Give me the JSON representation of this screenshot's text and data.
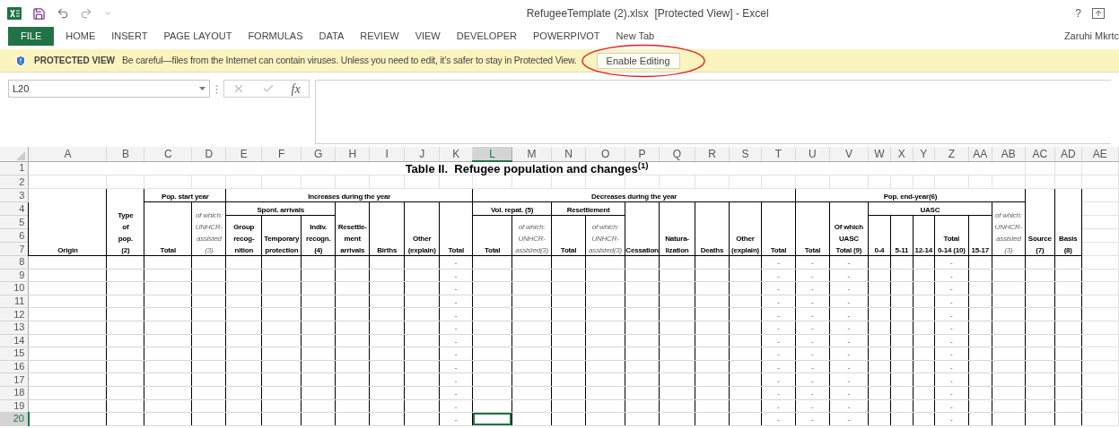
{
  "window": {
    "title": "RefugeeTemplate (2).xlsx  [Protected View] - Excel",
    "help": "?",
    "user": "Zaruhi Mkrtc"
  },
  "ribbon_tabs": [
    {
      "label": "FILE",
      "kind": "file"
    },
    {
      "label": "HOME",
      "kind": "tab"
    },
    {
      "label": "INSERT",
      "kind": "tab"
    },
    {
      "label": "PAGE LAYOUT",
      "kind": "tab"
    },
    {
      "label": "FORMULAS",
      "kind": "tab"
    },
    {
      "label": "DATA",
      "kind": "tab"
    },
    {
      "label": "REVIEW",
      "kind": "tab"
    },
    {
      "label": "VIEW",
      "kind": "tab"
    },
    {
      "label": "DEVELOPER",
      "kind": "tab"
    },
    {
      "label": "POWERPIVOT",
      "kind": "tab"
    },
    {
      "label": "New Tab",
      "kind": "tab"
    }
  ],
  "protected_view": {
    "title": "PROTECTED VIEW",
    "message": "Be careful—files from the Internet can contain viruses. Unless you need to edit, it’s safer to stay in Protected View.",
    "button": "Enable Editing"
  },
  "formula_bar": {
    "name_box": "L20",
    "function_label": "fx"
  },
  "sheet": {
    "columns": [
      {
        "label": "A",
        "selected": false
      },
      {
        "label": "B",
        "selected": false
      },
      {
        "label": "C",
        "selected": false
      },
      {
        "label": "D",
        "selected": false
      },
      {
        "label": "E",
        "selected": false
      },
      {
        "label": "F",
        "selected": false
      },
      {
        "label": "G",
        "selected": false
      },
      {
        "label": "H",
        "selected": false
      },
      {
        "label": "I",
        "selected": false
      },
      {
        "label": "J",
        "selected": false
      },
      {
        "label": "K",
        "selected": false
      },
      {
        "label": "L",
        "selected": true
      },
      {
        "label": "M",
        "selected": false
      },
      {
        "label": "N",
        "selected": false
      },
      {
        "label": "O",
        "selected": false
      },
      {
        "label": "P",
        "selected": false
      },
      {
        "label": "Q",
        "selected": false
      },
      {
        "label": "R",
        "selected": false
      },
      {
        "label": "S",
        "selected": false
      },
      {
        "label": "T",
        "selected": false
      },
      {
        "label": "U",
        "selected": false
      },
      {
        "label": "V",
        "selected": false
      },
      {
        "label": "W",
        "selected": false
      },
      {
        "label": "X",
        "selected": false
      },
      {
        "label": "Y",
        "selected": false
      },
      {
        "label": "Z",
        "selected": false
      },
      {
        "label": "AA",
        "selected": false
      },
      {
        "label": "AB",
        "selected": false
      },
      {
        "label": "AC",
        "selected": false
      },
      {
        "label": "AD",
        "selected": false
      },
      {
        "label": "AE",
        "selected": false
      }
    ],
    "title": "Table II.  Refugee population and changes$^{(1)}$",
    "header_cells": [
      {
        "text": "Pop. start year",
        "italic": false
      },
      {
        "text": "Increases during the year",
        "italic": false
      },
      {
        "text": "Decreases during the year",
        "italic": false
      },
      {
        "text": "Pop. end-year(6)",
        "italic": false
      },
      {
        "text": "Spont. arrivals",
        "italic": false
      },
      {
        "text": "Vol. repat. (5)",
        "italic": false
      },
      {
        "text": "Resettlement",
        "italic": false
      },
      {
        "text": "UASC",
        "italic": false
      },
      {
        "text": "Origin",
        "italic": false
      },
      {
        "text": "Type\nof\npop.\n(2)",
        "italic": false
      },
      {
        "text": "Total",
        "italic": false
      },
      {
        "text": "of which:\nUNHCR-\nassisted\n(3)",
        "italic": true
      },
      {
        "text": "Group\nrecog-\nnition",
        "italic": false
      },
      {
        "text": "Temporary\nprotection",
        "italic": false
      },
      {
        "text": "Indiv.\nrecogn.\n(4)",
        "italic": false
      },
      {
        "text": "Resettle-\nment\narrivals",
        "italic": false
      },
      {
        "text": "Births",
        "italic": false
      },
      {
        "text": "Other\n(explain)",
        "italic": false
      },
      {
        "text": "Total",
        "italic": false
      },
      {
        "text": "Total",
        "italic": false
      },
      {
        "text": "of which:\nUNHCR-\nassisted(3)",
        "italic": true
      },
      {
        "text": "Total",
        "italic": false
      },
      {
        "text": "of which:\nUNHCR-\nassisted(3)",
        "italic": true
      },
      {
        "text": "Cessation",
        "italic": false
      },
      {
        "text": "Natura-\nlization",
        "italic": false
      },
      {
        "text": "Deaths",
        "italic": false
      },
      {
        "text": "Other\n(explain)",
        "italic": false
      },
      {
        "text": "Total",
        "italic": false
      },
      {
        "text": "Total",
        "italic": false
      },
      {
        "text": "Of which\nUASC\nTotal (9)",
        "italic": false
      },
      {
        "text": "0-4",
        "italic": false
      },
      {
        "text": "5-11",
        "italic": false
      },
      {
        "text": "12-14",
        "italic": false
      },
      {
        "text": "Total\n0-14 (10)",
        "italic": false
      },
      {
        "text": "15-17",
        "italic": false
      },
      {
        "text": "of which:\nUNHCR-\nassisted\n(3)",
        "italic": true
      },
      {
        "text": "Source\n(7)",
        "italic": false
      },
      {
        "text": "Basis\n(8)",
        "italic": false
      }
    ],
    "rows": [
      {
        "number": "1",
        "selected": false
      },
      {
        "number": "2",
        "selected": false
      },
      {
        "number": "3",
        "selected": false
      },
      {
        "number": "4",
        "selected": false
      },
      {
        "number": "5",
        "selected": false
      },
      {
        "number": "6",
        "selected": false
      },
      {
        "number": "7",
        "selected": false
      },
      {
        "number": "8",
        "selected": false,
        "cells": [
          null,
          null,
          null,
          null,
          null,
          null,
          null,
          null,
          null,
          null,
          "-",
          null,
          null,
          null,
          null,
          null,
          null,
          null,
          null,
          "-",
          "-",
          "-",
          null,
          null,
          null,
          "-",
          null,
          null,
          null,
          null,
          null
        ]
      },
      {
        "number": "9",
        "selected": false,
        "cells": [
          null,
          null,
          null,
          null,
          null,
          null,
          null,
          null,
          null,
          null,
          "-",
          null,
          null,
          null,
          null,
          null,
          null,
          null,
          null,
          "-",
          "-",
          "-",
          null,
          null,
          null,
          "-",
          null,
          null,
          null,
          null,
          null
        ]
      },
      {
        "number": "10",
        "selected": false,
        "cells": [
          null,
          null,
          null,
          null,
          null,
          null,
          null,
          null,
          null,
          null,
          "-",
          null,
          null,
          null,
          null,
          null,
          null,
          null,
          null,
          "-",
          "-",
          "-",
          null,
          null,
          null,
          "-",
          null,
          null,
          null,
          null,
          null
        ]
      },
      {
        "number": "11",
        "selected": false,
        "cells": [
          null,
          null,
          null,
          null,
          null,
          null,
          null,
          null,
          null,
          null,
          "-",
          null,
          null,
          null,
          null,
          null,
          null,
          null,
          null,
          "-",
          "-",
          "-",
          null,
          null,
          null,
          "-",
          null,
          null,
          null,
          null,
          null
        ]
      },
      {
        "number": "12",
        "selected": false,
        "cells": [
          null,
          null,
          null,
          null,
          null,
          null,
          null,
          null,
          null,
          null,
          "-",
          null,
          null,
          null,
          null,
          null,
          null,
          null,
          null,
          "-",
          "-",
          "-",
          null,
          null,
          null,
          "-",
          null,
          null,
          null,
          null,
          null
        ]
      },
      {
        "number": "13",
        "selected": false,
        "cells": [
          null,
          null,
          null,
          null,
          null,
          null,
          null,
          null,
          null,
          null,
          "-",
          null,
          null,
          null,
          null,
          null,
          null,
          null,
          null,
          "-",
          "-",
          "-",
          null,
          null,
          null,
          "-",
          null,
          null,
          null,
          null,
          null
        ]
      },
      {
        "number": "14",
        "selected": false,
        "cells": [
          null,
          null,
          null,
          null,
          null,
          null,
          null,
          null,
          null,
          null,
          "-",
          null,
          null,
          null,
          null,
          null,
          null,
          null,
          null,
          "-",
          "-",
          "-",
          null,
          null,
          null,
          "-",
          null,
          null,
          null,
          null,
          null
        ]
      },
      {
        "number": "15",
        "selected": false,
        "cells": [
          null,
          null,
          null,
          null,
          null,
          null,
          null,
          null,
          null,
          null,
          "-",
          null,
          null,
          null,
          null,
          null,
          null,
          null,
          null,
          "-",
          "-",
          "-",
          null,
          null,
          null,
          "-",
          null,
          null,
          null,
          null,
          null
        ]
      },
      {
        "number": "16",
        "selected": false,
        "cells": [
          null,
          null,
          null,
          null,
          null,
          null,
          null,
          null,
          null,
          null,
          "-",
          null,
          null,
          null,
          null,
          null,
          null,
          null,
          null,
          "-",
          "-",
          "-",
          null,
          null,
          null,
          "-",
          null,
          null,
          null,
          null,
          null
        ]
      },
      {
        "number": "17",
        "selected": false,
        "cells": [
          null,
          null,
          null,
          null,
          null,
          null,
          null,
          null,
          null,
          null,
          "-",
          null,
          null,
          null,
          null,
          null,
          null,
          null,
          null,
          "-",
          "-",
          "-",
          null,
          null,
          null,
          "-",
          null,
          null,
          null,
          null,
          null
        ]
      },
      {
        "number": "18",
        "selected": false,
        "cells": [
          null,
          null,
          null,
          null,
          null,
          null,
          null,
          null,
          null,
          null,
          "-",
          null,
          null,
          null,
          null,
          null,
          null,
          null,
          null,
          "-",
          "-",
          "-",
          null,
          null,
          null,
          "-",
          null,
          null,
          null,
          null,
          null
        ]
      },
      {
        "number": "19",
        "selected": false,
        "cells": [
          null,
          null,
          null,
          null,
          null,
          null,
          null,
          null,
          null,
          null,
          "-",
          null,
          null,
          null,
          null,
          null,
          null,
          null,
          null,
          "-",
          "-",
          "-",
          null,
          null,
          null,
          "-",
          null,
          null,
          null,
          null,
          null
        ]
      },
      {
        "number": "20",
        "selected": true,
        "cells": [
          null,
          null,
          null,
          null,
          null,
          null,
          null,
          null,
          null,
          null,
          "-",
          null,
          null,
          null,
          null,
          null,
          null,
          null,
          null,
          "-",
          "-",
          "-",
          null,
          null,
          null,
          "-",
          null,
          null,
          null,
          null,
          null
        ]
      }
    ]
  }
}
